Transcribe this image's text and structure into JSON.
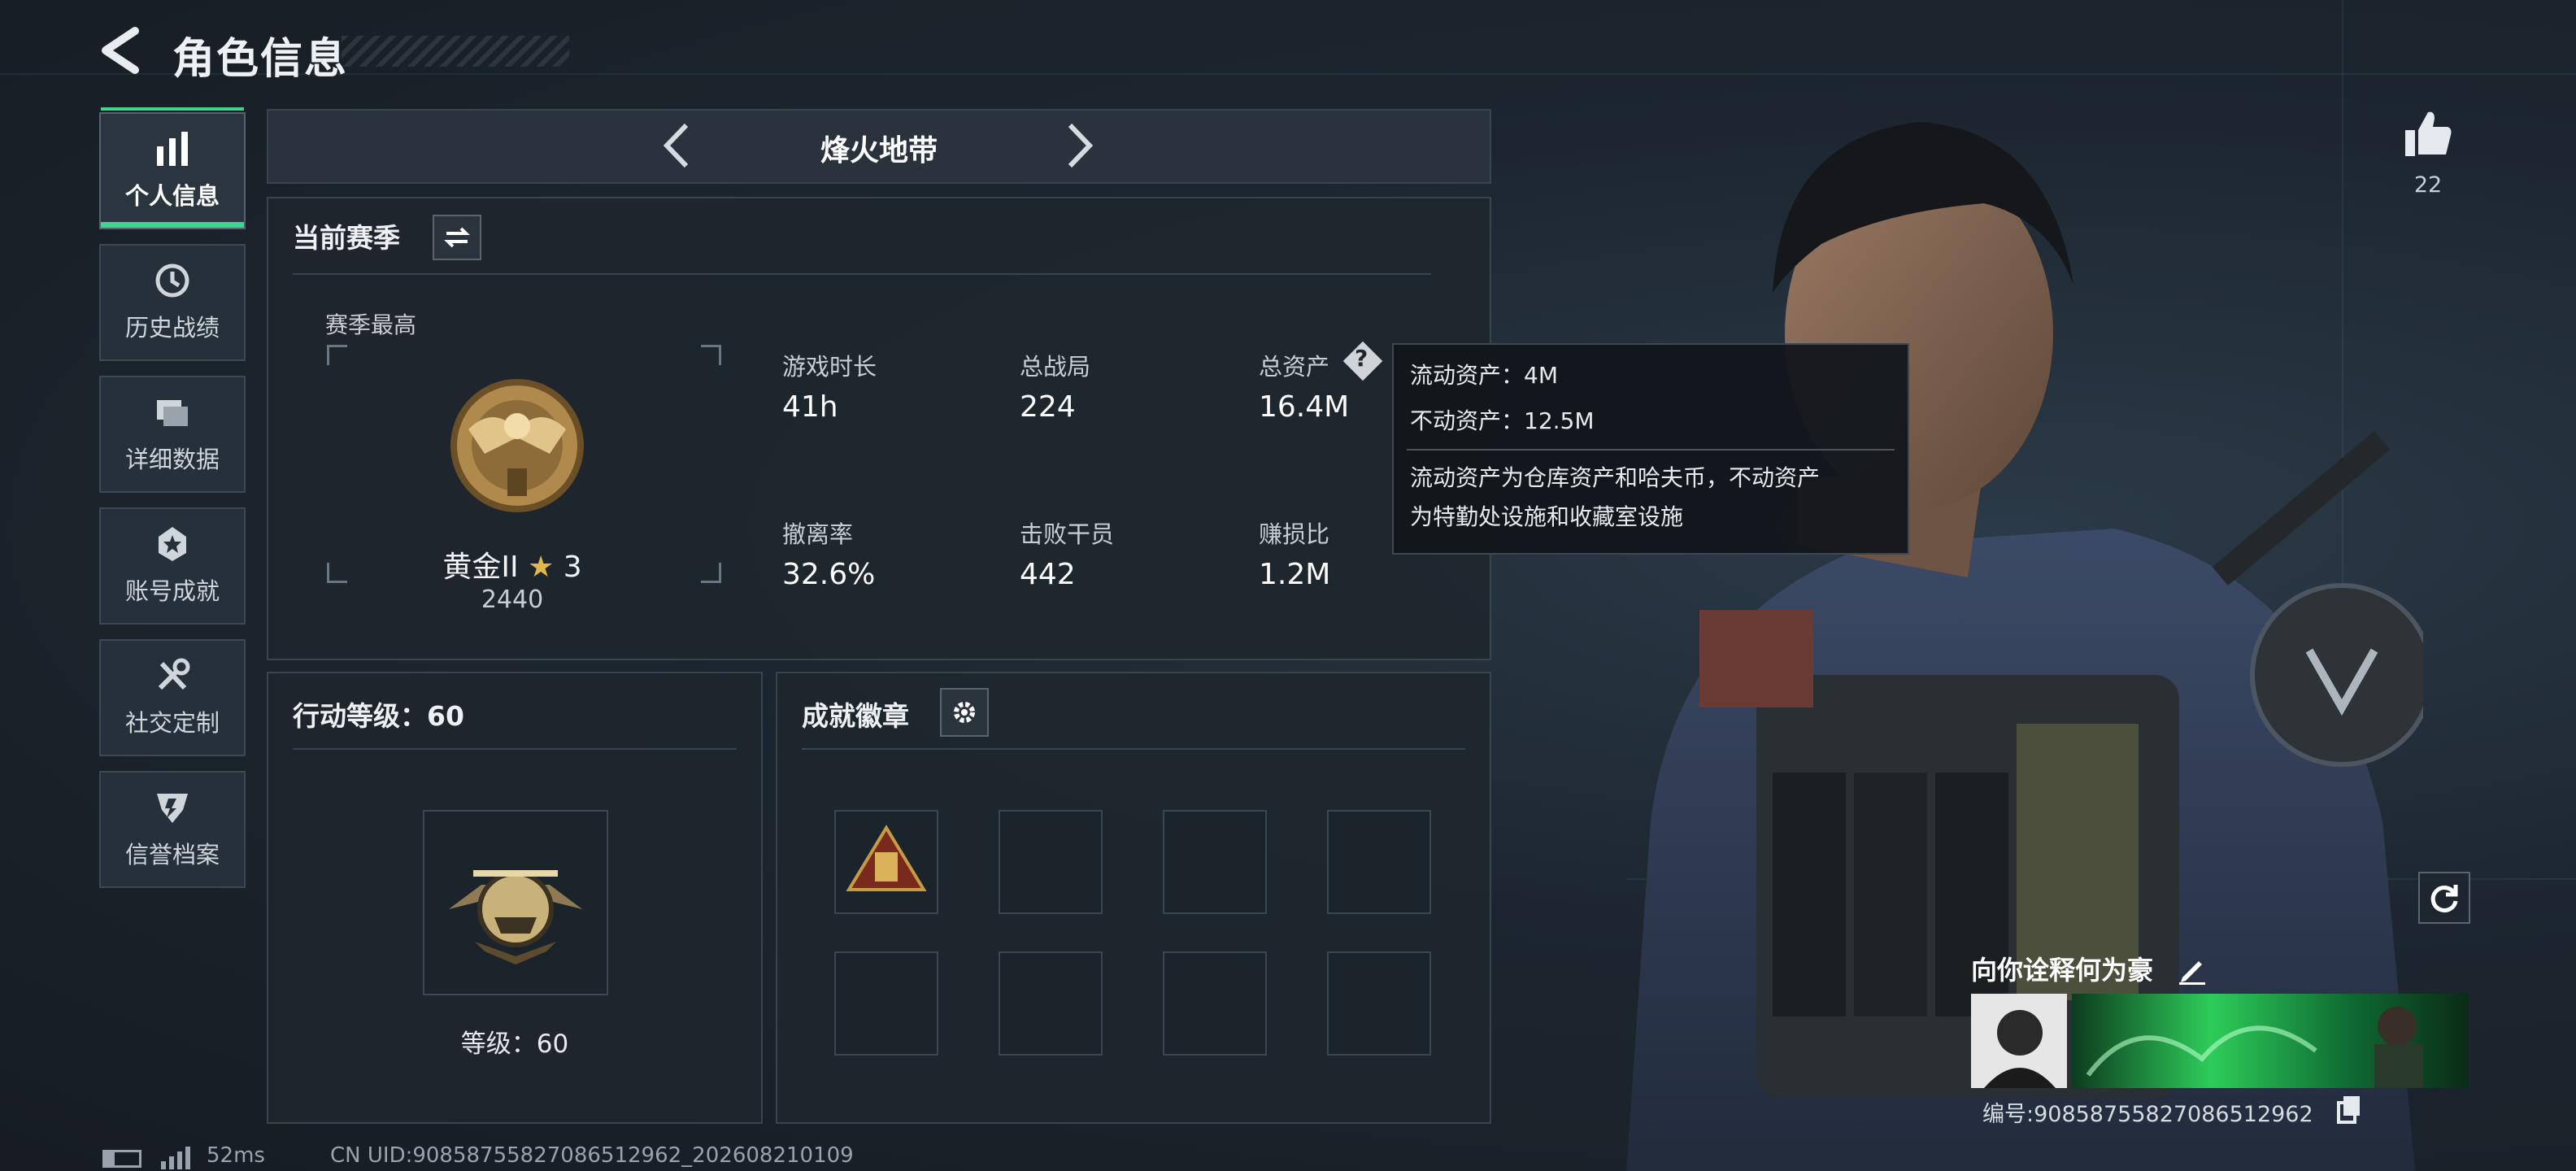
{
  "header": {
    "title": "角色信息"
  },
  "sidebar": {
    "items": [
      {
        "label": "个人信息",
        "icon": "bar-chart-icon"
      },
      {
        "label": "历史战绩",
        "icon": "clock-history-icon"
      },
      {
        "label": "详细数据",
        "icon": "folder-stack-icon"
      },
      {
        "label": "账号成就",
        "icon": "achievement-badge-icon"
      },
      {
        "label": "社交定制",
        "icon": "tools-icon"
      },
      {
        "label": "信誉档案",
        "icon": "credit-shield-icon"
      }
    ]
  },
  "mode_bar": {
    "title": "烽火地带"
  },
  "season": {
    "title": "当前赛季",
    "best_label": "赛季最高",
    "rank_name": "黄金II",
    "rank_stars": "3",
    "rank_score": "2440",
    "stats": [
      {
        "label": "游戏时长",
        "value": "41h"
      },
      {
        "label": "总战局",
        "value": "224"
      },
      {
        "label": "总资产",
        "value": "16.4M"
      },
      {
        "label": "撤离率",
        "value": "32.6%"
      },
      {
        "label": "击败干员",
        "value": "442"
      },
      {
        "label": "赚损比",
        "value": "1.2M"
      }
    ]
  },
  "tooltip": {
    "line1": "流动资产：4M",
    "line2": "不动资产：12.5M",
    "desc1": "流动资产为仓库资产和哈夫币，不动资产",
    "desc2": "为特勤处设施和收藏室设施"
  },
  "action_level": {
    "title": "行动等级：60",
    "level_label": "等级：60"
  },
  "badges": {
    "title": "成就徽章"
  },
  "likes": {
    "count": "22"
  },
  "profile": {
    "signature": "向你诠释何为豪",
    "id_text": "编号:9085875582708651296​2"
  },
  "footer": {
    "ping": "52ms",
    "uid": "CN UID:9085875582708651296​2_202608210109"
  },
  "colors": {
    "accent": "#3dd68c",
    "panel": "#1e262e",
    "border": "#3a444e"
  }
}
